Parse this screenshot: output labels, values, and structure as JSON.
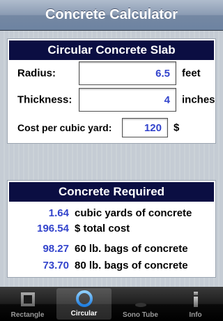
{
  "navbar": {
    "title": "Concrete Calculator"
  },
  "slab": {
    "header": "Circular Concrete Slab",
    "radius": {
      "label": "Radius:",
      "value": "6.5",
      "unit": "feet"
    },
    "thickness": {
      "label": "Thickness:",
      "value": "4",
      "unit": "inches"
    },
    "cost": {
      "label": "Cost per cubic yard:",
      "value": "120",
      "unit": "$"
    }
  },
  "results": {
    "header": "Concrete Required",
    "rows": [
      {
        "value": "1.64",
        "text": "cubic yards of concrete"
      },
      {
        "value": "196.54",
        "text": "$ total cost"
      },
      {
        "value": "98.27",
        "text": "60 lb. bags of concrete"
      },
      {
        "value": "73.70",
        "text": "80 lb. bags of concrete"
      }
    ]
  },
  "tabs": [
    {
      "label": "Rectangle",
      "icon": "square-icon",
      "active": false
    },
    {
      "label": "Circular",
      "icon": "circle-icon",
      "active": true
    },
    {
      "label": "Sono Tube",
      "icon": "tube-icon",
      "active": false
    },
    {
      "label": "Info",
      "icon": "info-icon",
      "active": false
    }
  ],
  "colors": {
    "header_bg": "#0b0e42",
    "value_blue": "#3344cc"
  }
}
